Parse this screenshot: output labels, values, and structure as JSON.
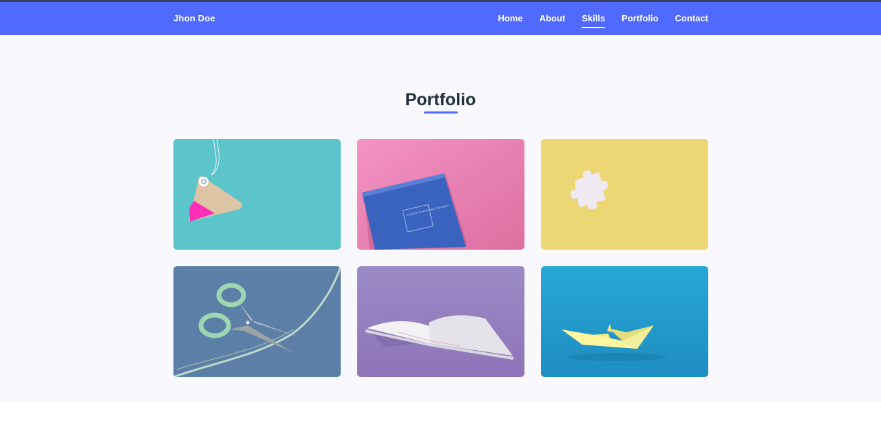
{
  "nav": {
    "brand": "Jhon Doe",
    "links": [
      "Home",
      "About",
      "Skills",
      "Portfolio",
      "Contact"
    ],
    "active": "Skills"
  },
  "portfolio": {
    "title": "Portfolio",
    "items": [
      {
        "subject": "price-tag",
        "color": "#5cc5cc"
      },
      {
        "subject": "blue-notebook",
        "color": "#ec8bb8"
      },
      {
        "subject": "puzzle-piece",
        "color": "#ecd774"
      },
      {
        "subject": "scissors",
        "color": "#5b7fa6"
      },
      {
        "subject": "open-book",
        "color": "#9987c2"
      },
      {
        "subject": "paper-boat",
        "color": "#27a7d6"
      }
    ],
    "notebook_text": "MY SECRET PLAN TO RULE THE WORLD"
  },
  "colors": {
    "navbar": "#5069ff",
    "section_bg": "#f9f9fd",
    "title": "#23323c",
    "accent": "#5069ff"
  }
}
